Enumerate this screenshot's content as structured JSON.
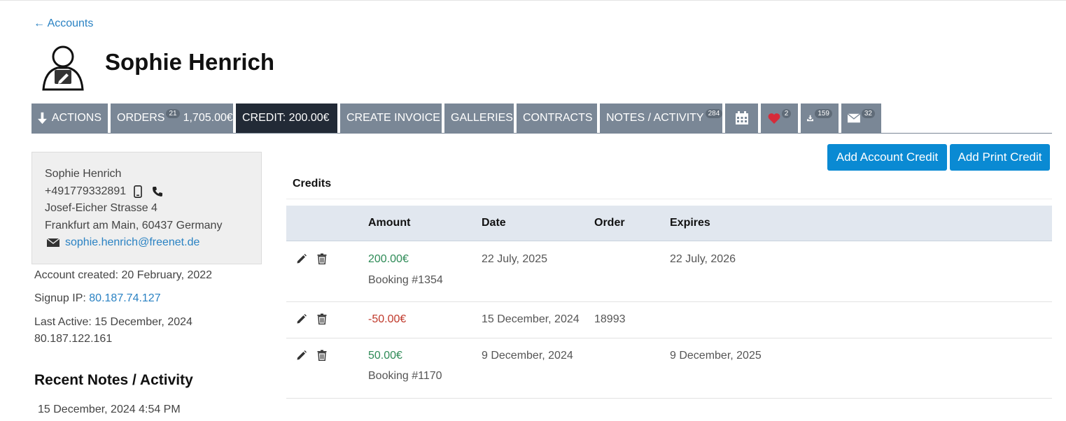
{
  "nav": {
    "back_label": "← Accounts"
  },
  "account": {
    "name": "Sophie Henrich"
  },
  "tabs": {
    "actions": "ACTIONS",
    "orders": "ORDERS",
    "orders_count": "21",
    "orders_total": "1,705.00€",
    "credit": "CREDIT: 200.00€",
    "create_invoice": "CREATE INVOICE",
    "galleries": "GALLERIES",
    "contracts": "CONTRACTS",
    "notes": "NOTES / ACTIVITY",
    "notes_count": "284",
    "favorites_count": "2",
    "downloads_count": "159",
    "emails_count": "32"
  },
  "contact": {
    "name": "Sophie Henrich",
    "phone": "+491779332891",
    "street": "Josef-Eicher Strasse 4",
    "city": "Frankfurt am Main, 60437 Germany",
    "email": "sophie.henrich@freenet.de"
  },
  "meta": {
    "created": "Account created: 20 February, 2022",
    "signup_label": "Signup IP:",
    "signup_ip": "80.187.74.127",
    "last_active": "Last Active: 15 December, 2024",
    "last_ip": "80.187.122.161"
  },
  "recent": {
    "title": "Recent Notes / Activity",
    "first_date": "15 December, 2024 4:54 PM"
  },
  "buttons": {
    "add_account_credit": "Add Account Credit",
    "add_print_credit": "Add Print Credit"
  },
  "credits": {
    "title": "Credits",
    "columns": {
      "amount": "Amount",
      "date": "Date",
      "order": "Order",
      "expires": "Expires"
    },
    "rows": [
      {
        "amount": "200.00€",
        "note": "Booking #1354",
        "date": "22 July, 2025",
        "order": "",
        "expires": "22 July, 2026"
      },
      {
        "amount": "-50.00€",
        "note": "",
        "date": "15 December, 2024",
        "order": "18993",
        "expires": ""
      },
      {
        "amount": "50.00€",
        "note": "Booking #1170",
        "date": "9 December, 2024",
        "order": "",
        "expires": "9 December, 2025"
      }
    ]
  },
  "colors": {
    "tab": "#7a8796",
    "tab_active": "#222a36",
    "primary": "#0a8ad3",
    "link": "#2a82c3",
    "positive": "#2e8b57",
    "negative": "#c0392b"
  }
}
